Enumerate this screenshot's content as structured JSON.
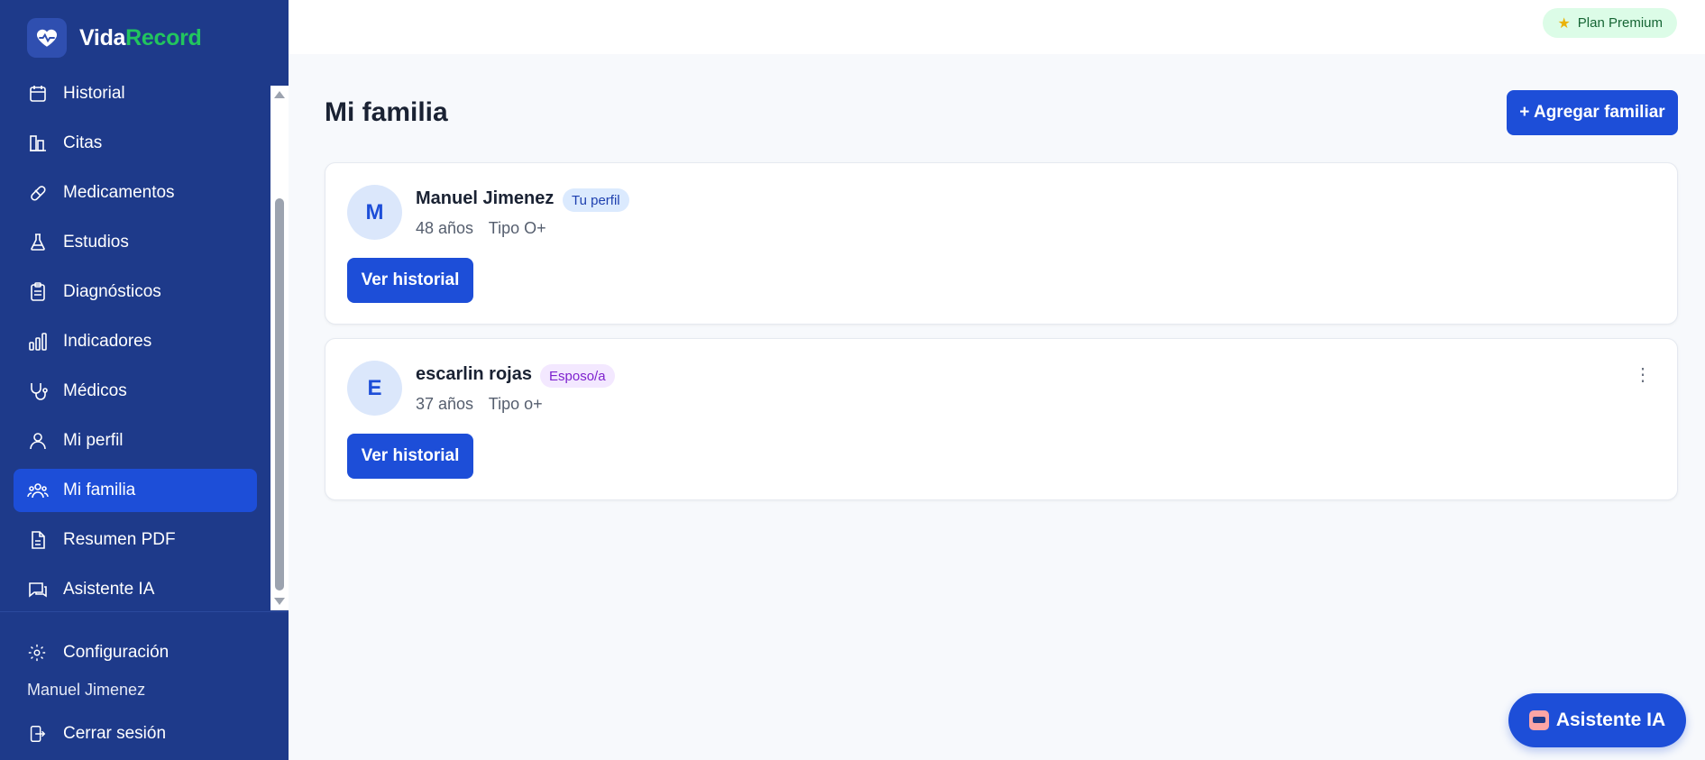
{
  "brand": {
    "name_part1": "Vida",
    "name_part2": "Record"
  },
  "sidebar": {
    "items": [
      {
        "label": "Historial",
        "icon": "calendar-icon"
      },
      {
        "label": "Citas",
        "icon": "building-icon"
      },
      {
        "label": "Medicamentos",
        "icon": "pill-icon"
      },
      {
        "label": "Estudios",
        "icon": "flask-icon"
      },
      {
        "label": "Diagnósticos",
        "icon": "clipboard-icon"
      },
      {
        "label": "Indicadores",
        "icon": "bar-chart-icon"
      },
      {
        "label": "Médicos",
        "icon": "stethoscope-icon"
      },
      {
        "label": "Mi perfil",
        "icon": "user-icon"
      },
      {
        "label": "Mi familia",
        "icon": "users-icon",
        "active": true
      },
      {
        "label": "Resumen PDF",
        "icon": "file-icon"
      },
      {
        "label": "Asistente IA",
        "icon": "chat-icon"
      }
    ],
    "settings_label": "Configuración",
    "user_name": "Manuel Jimenez",
    "logout_label": "Cerrar sesión"
  },
  "topbar": {
    "plan_label": "Plan Premium"
  },
  "main": {
    "title": "Mi familia",
    "add_button": "+ Agregar familiar",
    "members": [
      {
        "initial": "M",
        "name": "Manuel Jimenez",
        "tag": "Tu perfil",
        "age": "48 años",
        "blood": "Tipo O+",
        "button": "Ver historial"
      },
      {
        "initial": "E",
        "name": "escarlin rojas",
        "tag": "Esposo/a",
        "age": "37 años",
        "blood": "Tipo o+",
        "button": "Ver historial"
      }
    ]
  },
  "fab": {
    "label": "Asistente IA"
  },
  "colors": {
    "sidebar_bg": "#1e3a8a",
    "accent": "#1d4ed8",
    "brand_green": "#22c55e"
  }
}
